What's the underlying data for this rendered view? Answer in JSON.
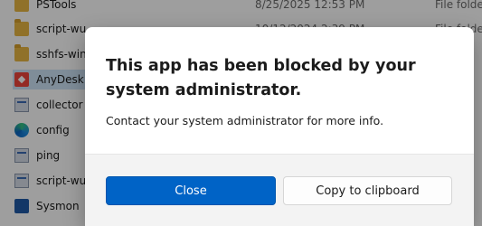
{
  "explorer": {
    "rows": [
      {
        "name": "PSTools",
        "date": "8/25/2025 12:53 PM",
        "type": "File folder",
        "icon": "folder-icon"
      },
      {
        "name": "script-wu",
        "date": "10/12/2024 2:39 PM",
        "type": "File folder",
        "icon": "folder-icon"
      },
      {
        "name": "sshfs-win",
        "date": "",
        "type": "",
        "icon": "folder-icon"
      },
      {
        "name": "AnyDesk",
        "date": "",
        "type": "",
        "icon": "anydesk-icon"
      },
      {
        "name": "collector",
        "date": "",
        "type": "",
        "icon": "exe-icon"
      },
      {
        "name": "config",
        "date": "",
        "type": "",
        "icon": "edge-icon"
      },
      {
        "name": "ping",
        "date": "",
        "type": "",
        "icon": "exe-icon"
      },
      {
        "name": "script-wu",
        "date": "",
        "type": "",
        "icon": "exe-icon"
      },
      {
        "name": "Sysmon",
        "date": "",
        "type": "",
        "icon": "sysmon-icon"
      }
    ]
  },
  "dialog": {
    "title": "This app has been blocked by your system administrator.",
    "message": "Contact your system administrator for more info.",
    "close_label": "Close",
    "copy_label": "Copy to clipboard"
  },
  "colors": {
    "primary_button": "#0063c6",
    "overlay": "rgba(0,0,0,0.38)",
    "footer": "#f3f3f3"
  }
}
